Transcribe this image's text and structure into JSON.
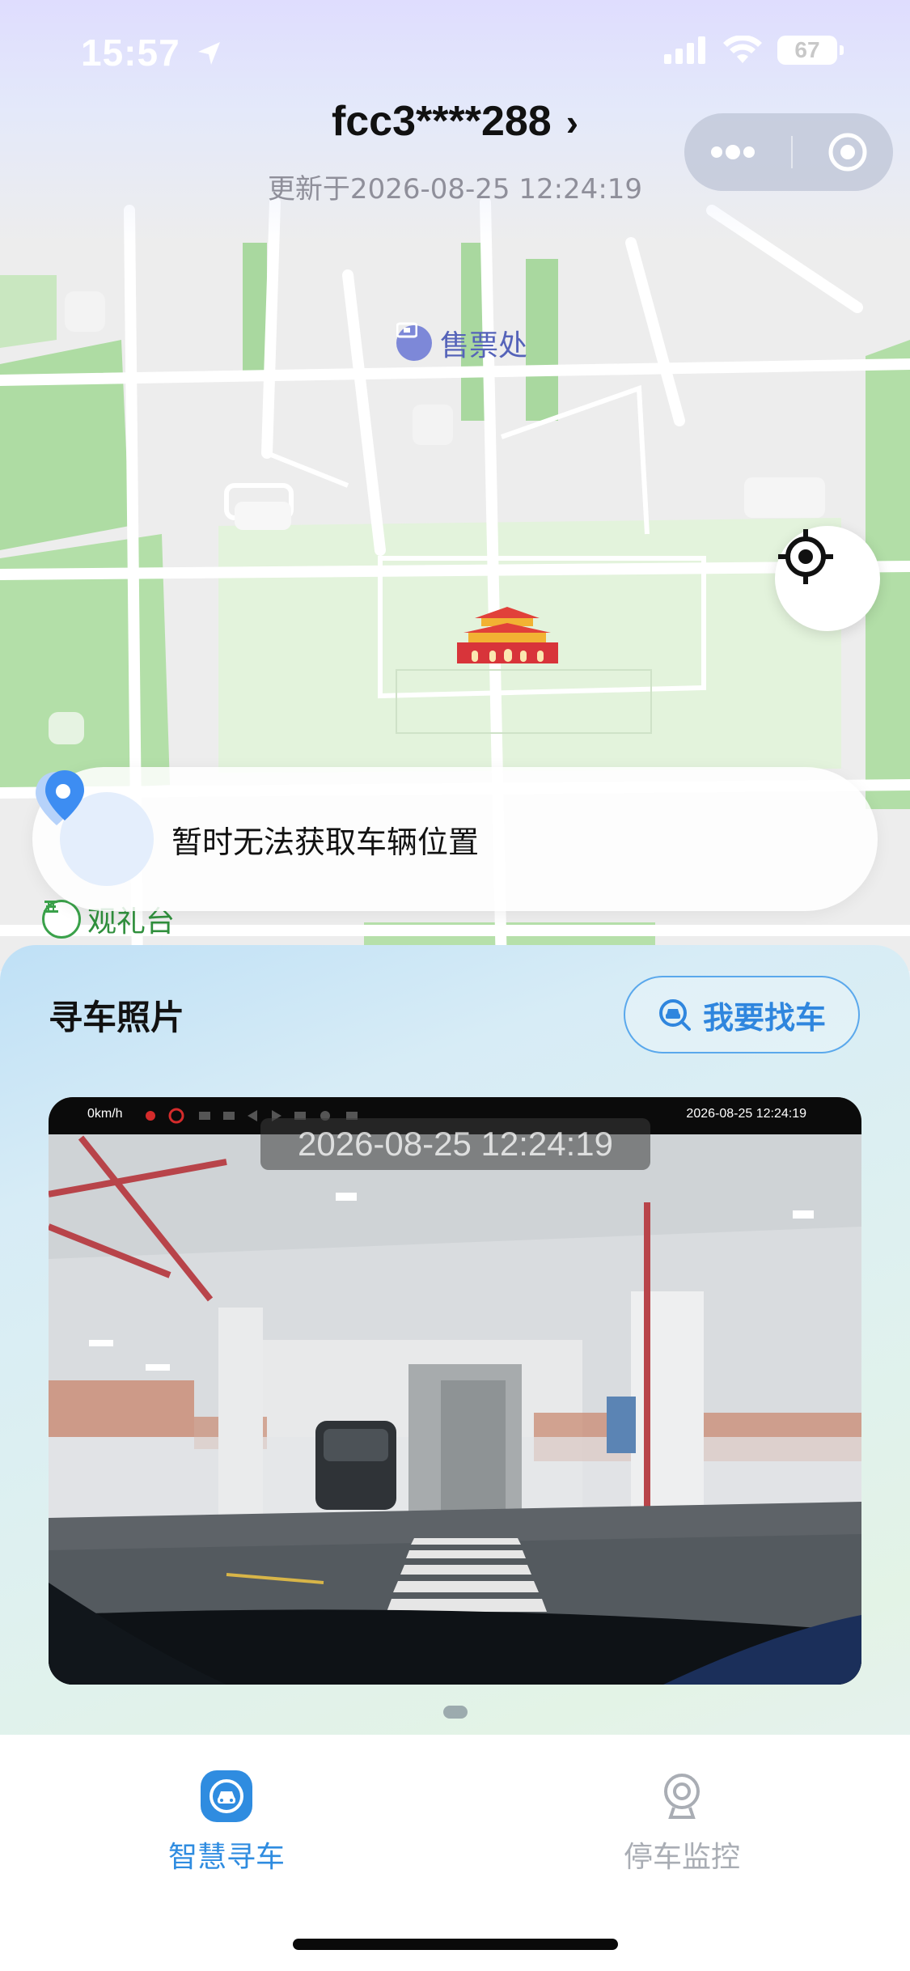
{
  "status_bar": {
    "time": "15:57",
    "battery": "67"
  },
  "header": {
    "plate": "fcc3****288",
    "chevron": "›",
    "updated": "更新于2026-08-25 12:24:19"
  },
  "map": {
    "poi_ticket": "售票处",
    "poi_platform": "观礼台",
    "location_message": "暂时无法获取车辆位置"
  },
  "sheet": {
    "title": "寻车照片",
    "find_button": "我要找车",
    "photo": {
      "timestamp_overlay": "2026-08-25 12:24:19",
      "cam_speed": "0km/h",
      "cam_timestamp": "2026-08-25 12:24:19"
    }
  },
  "tabs": [
    {
      "label": "智慧寻车",
      "active": true
    },
    {
      "label": "停车监控",
      "active": false
    }
  ],
  "colors": {
    "accent": "#2f8ce0",
    "park_green": "#a8dba0",
    "poi_blue": "#5563b9"
  }
}
